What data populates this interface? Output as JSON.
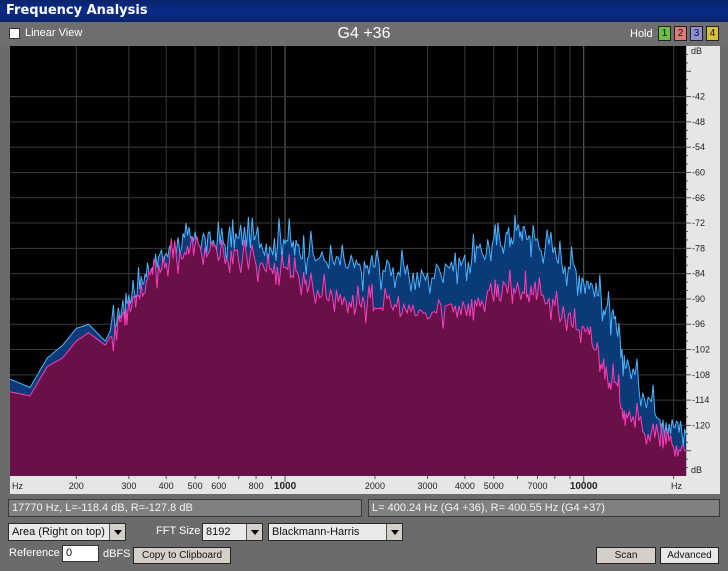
{
  "window": {
    "title": "Frequency Analysis"
  },
  "toolbar": {
    "linear_view_label": "Linear View",
    "note_reading": "G4 +36",
    "hold_label": "Hold",
    "hold_buttons": [
      {
        "label": "1",
        "color": "#6cc04a"
      },
      {
        "label": "2",
        "color": "#e07a7a"
      },
      {
        "label": "3",
        "color": "#9090d8"
      },
      {
        "label": "4",
        "color": "#d8c040"
      }
    ]
  },
  "colors": {
    "plot_bg": "#000000",
    "left_fill": "#0a3a78",
    "left_line": "#4ab4ff",
    "right_fill": "#6a1048",
    "right_line": "#ff3cb4",
    "grid": "#3a3a3a"
  },
  "chart_data": {
    "type": "area",
    "x_scale": "log",
    "xlim": [
      120,
      22000
    ],
    "ylim": [
      -132,
      -30
    ],
    "x_unit_label": "Hz",
    "y_unit_label": "dB",
    "x_ticks": [
      {
        "v": 200,
        "label": "200"
      },
      {
        "v": 300,
        "label": "300"
      },
      {
        "v": 400,
        "label": "400"
      },
      {
        "v": 500,
        "label": "500"
      },
      {
        "v": 600,
        "label": "600"
      },
      {
        "v": 800,
        "label": "800"
      },
      {
        "v": 1000,
        "label": "1000"
      },
      {
        "v": 2000,
        "label": "2000"
      },
      {
        "v": 3000,
        "label": "3000"
      },
      {
        "v": 4000,
        "label": "4000"
      },
      {
        "v": 5000,
        "label": "5000"
      },
      {
        "v": 7000,
        "label": "7000"
      },
      {
        "v": 10000,
        "label": "10000"
      }
    ],
    "y_ticks": [
      -42,
      -48,
      -54,
      -60,
      -66,
      -72,
      -78,
      -84,
      -90,
      -96,
      -102,
      -108,
      -114,
      -120
    ],
    "series": [
      {
        "name": "L",
        "x": [
          120,
          140,
          160,
          180,
          200,
          220,
          250,
          280,
          300,
          330,
          360,
          400,
          450,
          500,
          560,
          630,
          700,
          800,
          900,
          1000,
          1100,
          1200,
          1400,
          1600,
          1800,
          2000,
          2300,
          2600,
          3000,
          3500,
          4000,
          4500,
          5000,
          5500,
          6000,
          6500,
          7000,
          8000,
          9000,
          10000,
          11000,
          12000,
          13000,
          14000,
          16000,
          18000,
          20000,
          22000
        ],
        "y": [
          -109,
          -111,
          -104,
          -101,
          -97,
          -96,
          -100,
          -93,
          -89,
          -86,
          -82,
          -79,
          -77,
          -76,
          -76,
          -77,
          -76,
          -76,
          -77,
          -75,
          -78,
          -79,
          -81,
          -82,
          -83,
          -82,
          -83,
          -84,
          -85,
          -81,
          -81,
          -79,
          -77,
          -75,
          -74,
          -75,
          -76,
          -79,
          -82,
          -85,
          -88,
          -92,
          -99,
          -106,
          -112,
          -117,
          -120,
          -122
        ]
      },
      {
        "name": "R",
        "x": [
          120,
          140,
          160,
          180,
          200,
          220,
          250,
          280,
          300,
          330,
          360,
          400,
          450,
          500,
          560,
          630,
          700,
          800,
          900,
          1000,
          1100,
          1200,
          1400,
          1600,
          1800,
          2000,
          2300,
          2600,
          3000,
          3500,
          4000,
          4500,
          5000,
          5500,
          6000,
          6500,
          7000,
          8000,
          9000,
          10000,
          11000,
          12000,
          13000,
          14000,
          16000,
          18000,
          20000,
          22000
        ],
        "y": [
          -112,
          -113,
          -106,
          -104,
          -100,
          -98,
          -101,
          -95,
          -91,
          -88,
          -84,
          -81,
          -79,
          -78,
          -79,
          -80,
          -80,
          -81,
          -83,
          -82,
          -85,
          -87,
          -89,
          -90,
          -91,
          -91,
          -92,
          -93,
          -94,
          -92,
          -91,
          -91,
          -89,
          -88,
          -87,
          -88,
          -89,
          -92,
          -95,
          -98,
          -102,
          -107,
          -112,
          -117,
          -121,
          -124,
          -125,
          -126
        ]
      }
    ]
  },
  "status": {
    "cursor_readout": "17770 Hz, L=-118.4 dB, R=-127.8 dB",
    "peak_readout": "L= 400.24 Hz (G4 +36), R= 400.55 Hz (G4 +37)"
  },
  "controls": {
    "graph_mode": "Area (Right on top)",
    "fft_size_label": "FFT Size",
    "fft_size": "8192",
    "window_function": "Blackmann-Harris",
    "reference_label": "Reference",
    "reference_value": "0",
    "reference_unit": "dBFS",
    "copy_button": "Copy to Clipboard",
    "scan_button": "Scan",
    "advanced_button": "Advanced"
  }
}
